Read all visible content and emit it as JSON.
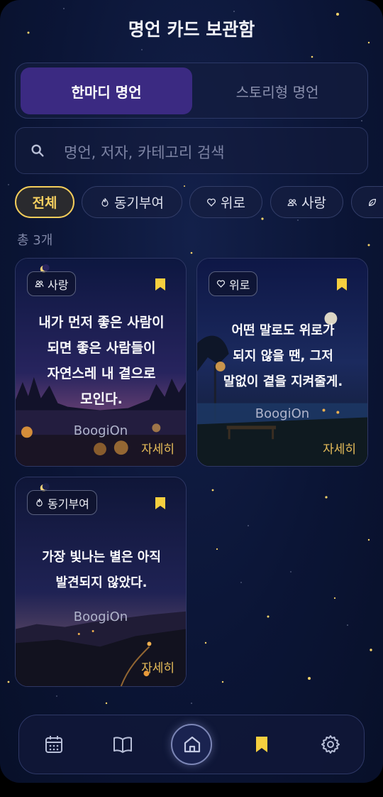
{
  "header": {
    "title": "명언 카드 보관함"
  },
  "tabs": [
    {
      "label": "한마디 명언",
      "active": true
    },
    {
      "label": "스토리형 명언",
      "active": false
    }
  ],
  "search": {
    "placeholder": "명언, 저자, 카테고리 검색",
    "icon": "search-icon"
  },
  "filters": [
    {
      "label": "전체",
      "icon": "",
      "active": true
    },
    {
      "label": "동기부여",
      "icon": "flame-icon",
      "active": false
    },
    {
      "label": "위로",
      "icon": "heart-icon",
      "active": false
    },
    {
      "label": "사랑",
      "icon": "people-icon",
      "active": false
    },
    {
      "label": "",
      "icon": "leaf-icon",
      "active": false
    }
  ],
  "count_label": "총 3개",
  "cards": [
    {
      "category": "사랑",
      "category_icon": "people-icon",
      "quote_lines": [
        "내가 먼저 좋은 사람이",
        "되면 좋은 사람들이",
        "자연스레 내 곁으로",
        "모인다."
      ],
      "author": "BoogiOn",
      "detail": "자세히",
      "bookmarked": true
    },
    {
      "category": "위로",
      "category_icon": "heart-icon",
      "quote_lines": [
        "어떤 말로도 위로가",
        "되지 않을 땐, 그저",
        "말없이 곁을 지켜줄게."
      ],
      "author": "BoogiOn",
      "detail": "자세히",
      "bookmarked": true
    },
    {
      "category": "동기부여",
      "category_icon": "flame-icon",
      "quote_lines": [
        "가장 빛나는 별은 아직",
        "발견되지 않았다."
      ],
      "author": "BoogiOn",
      "detail": "자세히",
      "bookmarked": true
    }
  ],
  "navbar": [
    {
      "icon": "calendar-icon",
      "active": false
    },
    {
      "icon": "book-icon",
      "active": false
    },
    {
      "icon": "home-icon",
      "active": false
    },
    {
      "icon": "bookmark-icon",
      "active": true
    },
    {
      "icon": "gear-icon",
      "active": false
    }
  ],
  "colors": {
    "background": "#0b1536",
    "accent_purple": "#3b2a82",
    "accent_gold": "#f3cd5b",
    "detail_gold": "#e8be5a"
  }
}
